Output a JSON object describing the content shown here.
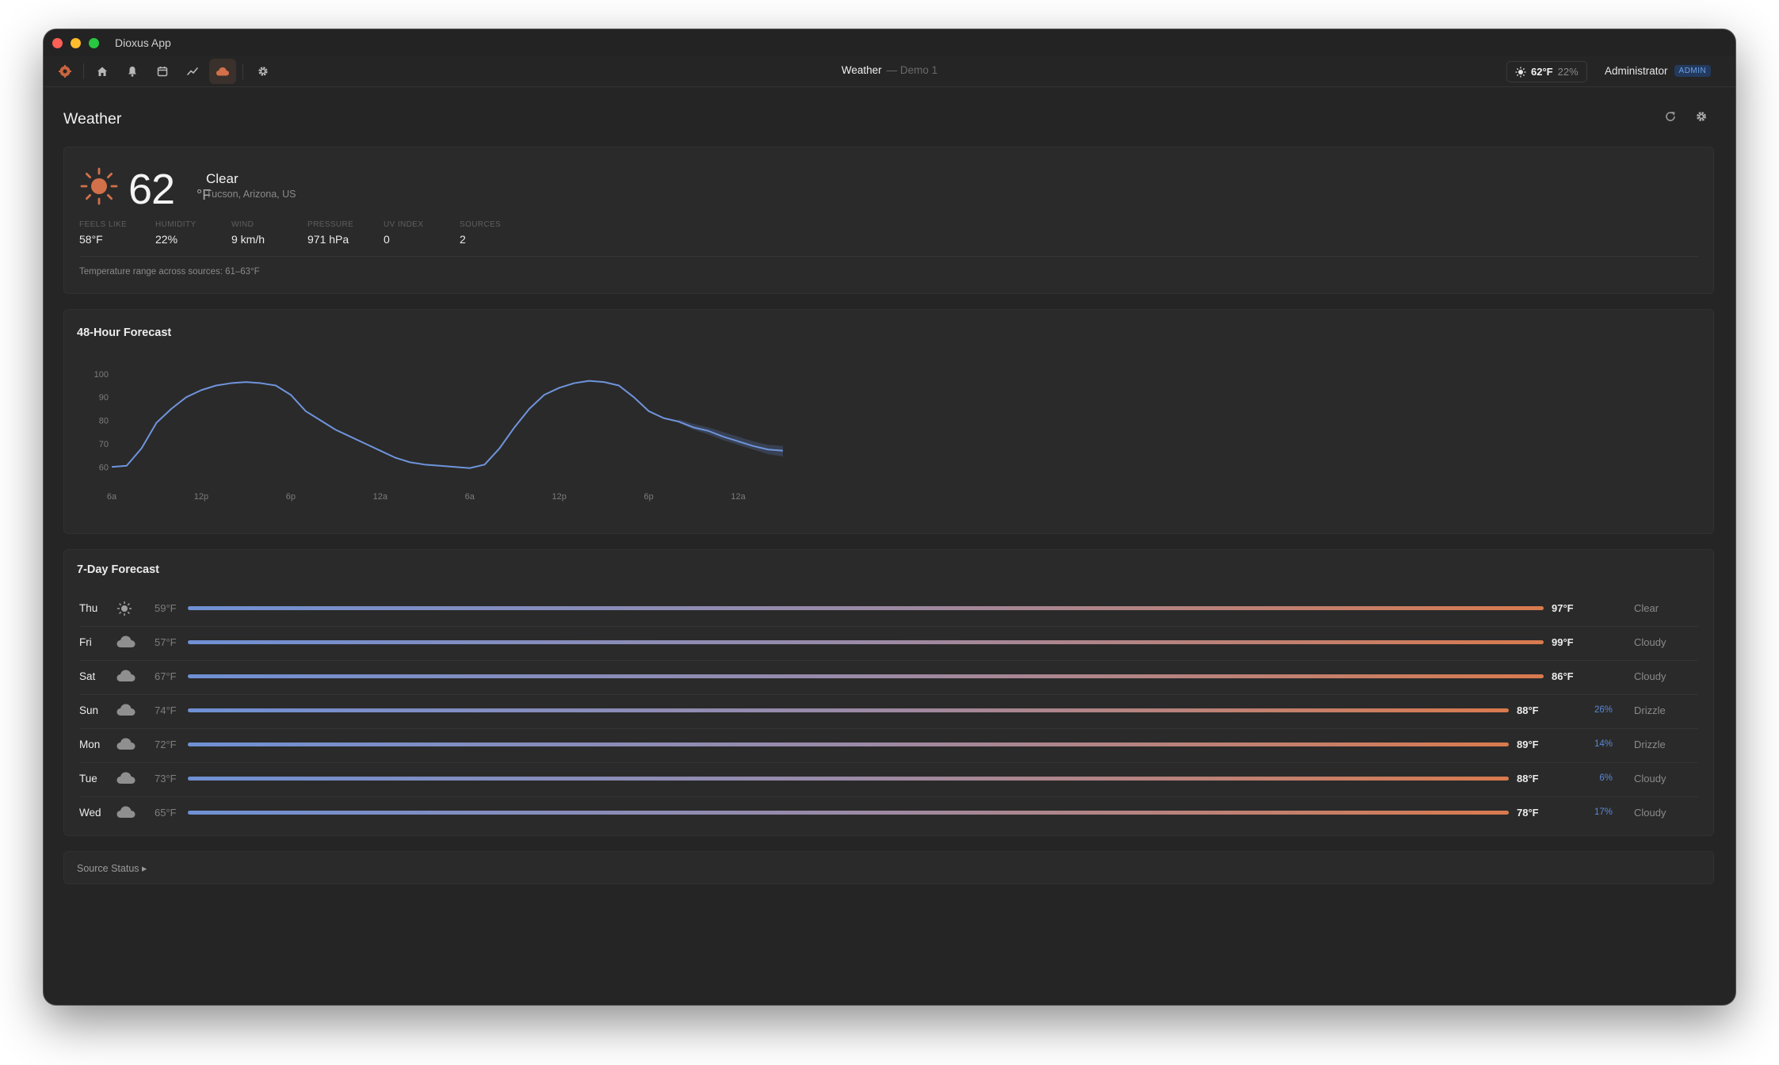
{
  "window": {
    "app_title": "Dioxus App"
  },
  "toolbar": {
    "center_title": "Weather",
    "center_sub": "— Demo 1",
    "chip_temp": "62°F",
    "chip_humidity": "22%",
    "user_name": "Administrator",
    "user_badge": "ADMIN",
    "icons": [
      "logo-icon",
      "home-icon",
      "bell-icon",
      "calendar-icon",
      "chart-icon",
      "cloud-icon",
      "gear-icon"
    ]
  },
  "page": {
    "title": "Weather"
  },
  "current": {
    "temp": "62",
    "unit": "°F",
    "condition": "Clear",
    "location": "Tucson, Arizona, US",
    "stats": [
      {
        "label": "Feels like",
        "value": "58°F"
      },
      {
        "label": "Humidity",
        "value": "22%"
      },
      {
        "label": "Wind",
        "value": "9 km/h"
      },
      {
        "label": "Pressure",
        "value": "971 hPa"
      },
      {
        "label": "UV Index",
        "value": "0"
      },
      {
        "label": "Sources",
        "value": "2"
      }
    ],
    "range_note": "Temperature range across sources: 61–63°F"
  },
  "forecast48": {
    "title": "48-Hour Forecast",
    "chart_data": {
      "type": "line",
      "x_ticks": [
        "6a",
        "12p",
        "6p",
        "12a",
        "6a",
        "12p",
        "6p",
        "12a"
      ],
      "y_ticks": [
        60,
        70,
        80,
        90,
        100
      ],
      "ylim": [
        56,
        103
      ],
      "series": [
        {
          "values": [
            60,
            60.5,
            68,
            79,
            85,
            90,
            93,
            95,
            96,
            96.5,
            96,
            95,
            91,
            84,
            80,
            76,
            73,
            70,
            67,
            64,
            62,
            61,
            60.5,
            60,
            59.5,
            61,
            68,
            77,
            85,
            91,
            94,
            96,
            97,
            96.5,
            95,
            90,
            84,
            81,
            79.5,
            77,
            75.5,
            73,
            71,
            69,
            67.5,
            67
          ],
          "band_low": [
            null,
            null,
            null,
            null,
            null,
            null,
            null,
            null,
            null,
            null,
            null,
            null,
            null,
            null,
            null,
            null,
            null,
            null,
            null,
            null,
            null,
            null,
            null,
            null,
            null,
            null,
            null,
            null,
            null,
            null,
            null,
            null,
            null,
            null,
            null,
            null,
            null,
            null,
            79,
            76,
            74,
            71.5,
            69.5,
            67.5,
            65.5,
            64.5
          ],
          "band_high": [
            null,
            null,
            null,
            null,
            null,
            null,
            null,
            null,
            null,
            null,
            null,
            null,
            null,
            null,
            null,
            null,
            null,
            null,
            null,
            null,
            null,
            null,
            null,
            null,
            null,
            null,
            null,
            null,
            null,
            null,
            null,
            null,
            null,
            null,
            null,
            null,
            null,
            null,
            80.5,
            78.5,
            77,
            75,
            73,
            71,
            69.5,
            69
          ]
        }
      ],
      "colors": {
        "line": "#6f94dc",
        "band": "#4a5e86"
      }
    }
  },
  "forecast7": {
    "title": "7-Day Forecast",
    "colors": {
      "bar_start": "#6f90d4",
      "bar_end": "#d97a4e",
      "precip": "#5b88d6"
    },
    "days": [
      {
        "day": "Thu",
        "icon": "sun-icon",
        "low": "59°F",
        "high": "97°F",
        "precip": "",
        "condition": "Clear"
      },
      {
        "day": "Fri",
        "icon": "cloud-icon",
        "low": "57°F",
        "high": "99°F",
        "precip": "",
        "condition": "Cloudy"
      },
      {
        "day": "Sat",
        "icon": "cloud-icon",
        "low": "67°F",
        "high": "86°F",
        "precip": "",
        "condition": "Cloudy"
      },
      {
        "day": "Sun",
        "icon": "cloud-icon",
        "low": "74°F",
        "high": "88°F",
        "precip": "26%",
        "condition": "Drizzle"
      },
      {
        "day": "Mon",
        "icon": "cloud-icon",
        "low": "72°F",
        "high": "89°F",
        "precip": "14%",
        "condition": "Drizzle"
      },
      {
        "day": "Tue",
        "icon": "cloud-icon",
        "low": "73°F",
        "high": "88°F",
        "precip": "6%",
        "condition": "Cloudy"
      },
      {
        "day": "Wed",
        "icon": "cloud-icon",
        "low": "65°F",
        "high": "78°F",
        "precip": "17%",
        "condition": "Cloudy"
      }
    ]
  },
  "source_status": {
    "label": "Source Status ▸"
  }
}
